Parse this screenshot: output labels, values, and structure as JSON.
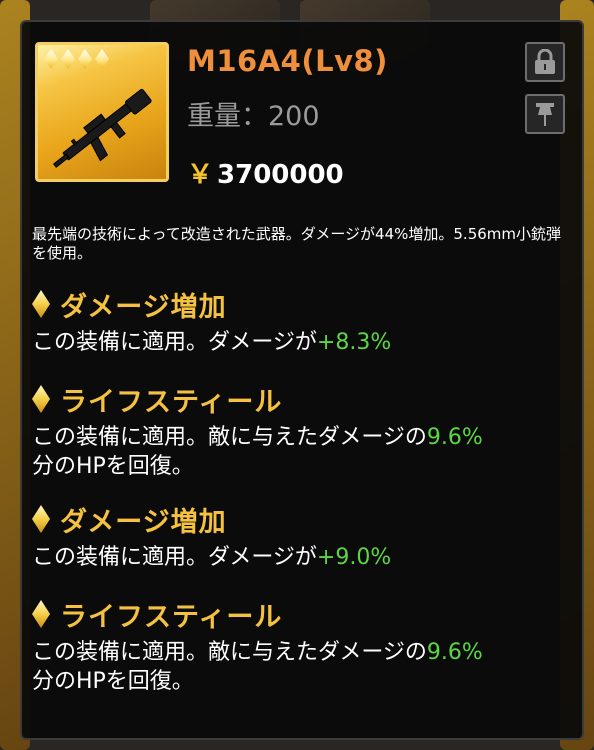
{
  "item": {
    "name": "M16A4(Lv8)",
    "weight": "重量：200",
    "currency_symbol": "￥",
    "price": "3700000",
    "description": "最先端の技術によって改造された武器。ダメージが44%増加。5.56mm小銃弾を使用。"
  },
  "perks": [
    {
      "name": "ダメージ増加",
      "text_before": "この装備に適用。ダメージが",
      "value": "+8.3%",
      "text_after": ""
    },
    {
      "name": "ライフスティール",
      "text_before": "この装備に適用。敵に与えたダメージの",
      "value": "9.6%",
      "text_after": "分のHPを回復。"
    },
    {
      "name": "ダメージ増加",
      "text_before": "この装備に適用。ダメージが",
      "value": "+9.0%",
      "text_after": ""
    },
    {
      "name": "ライフスティール",
      "text_before": "この装備に適用。敵に与えたダメージの",
      "value": "9.6%",
      "text_after": "分のHPを回復。"
    }
  ],
  "icons": {
    "rarity": "diamond-star-icon",
    "lock": "lock-icon",
    "pin": "pin-icon",
    "weapon": "rifle-icon"
  },
  "colors": {
    "title": "#f08f3b",
    "perk_name": "#f4c240",
    "value_green": "#5cd646",
    "frame_gold": "#f3cf62"
  }
}
